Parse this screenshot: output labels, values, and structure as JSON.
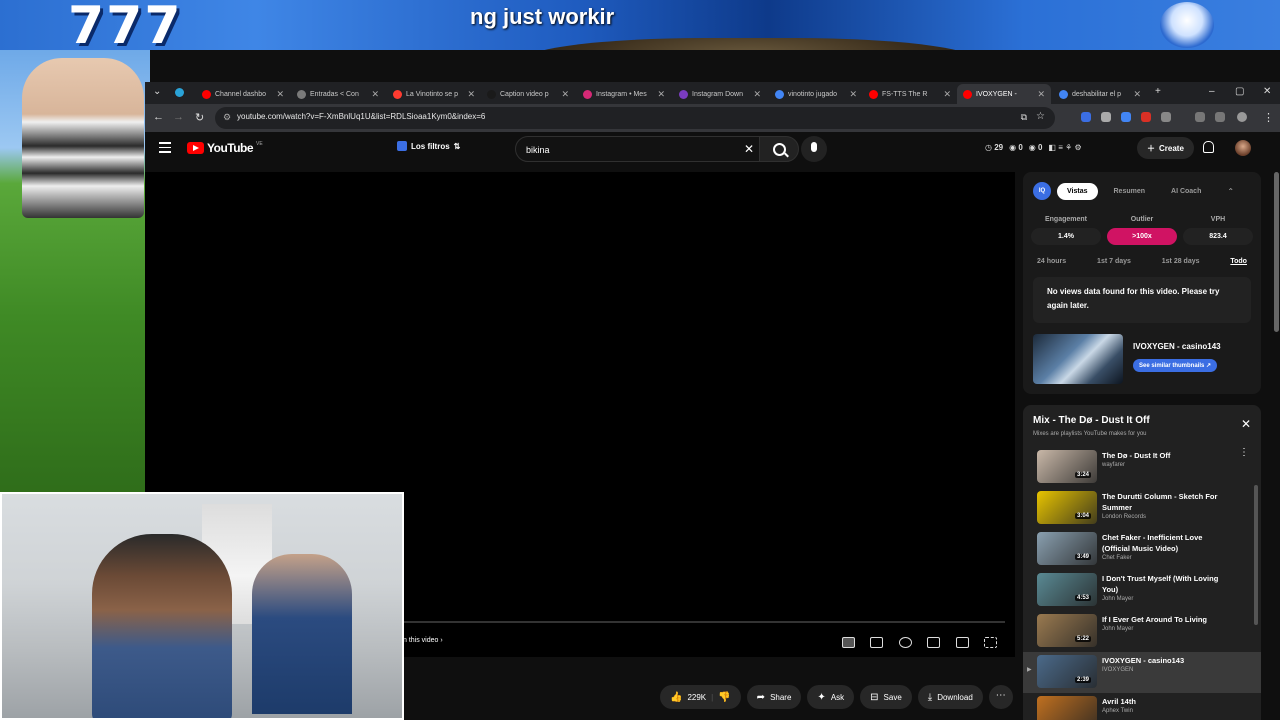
{
  "stream": {
    "overlay_number": "777",
    "caption": "ng just workir"
  },
  "browser": {
    "tabs": [
      {
        "label": "Channel dashbo",
        "color": "#ff0000"
      },
      {
        "label": "Entradas < Con",
        "color": "#7a7a7a"
      },
      {
        "label": "La Vinotinto se p",
        "color": "#ff3b30"
      },
      {
        "label": "Caption video p",
        "color": "#1a1a1a"
      },
      {
        "label": "Instagram • Mes",
        "color": "#d62976"
      },
      {
        "label": "Instagram Down",
        "color": "#7a3cc0"
      },
      {
        "label": "vinotinto jugado",
        "color": "#4285f4"
      },
      {
        "label": "FS-TTS The R",
        "color": "#ff0000"
      },
      {
        "label": "IVOXYGEN - ",
        "color": "#ff0000"
      },
      {
        "label": "deshabilitar el p",
        "color": "#4285f4"
      }
    ],
    "url": "youtube.com/watch?v=F-XmBnlUq1U&list=RDLSioaa1Kym0&index=6"
  },
  "youtube": {
    "logo_text": "YouTube",
    "logo_region": "VE",
    "filters_label": "Los filtros",
    "search_value": "bikina",
    "stats": [
      "29",
      "0",
      "0"
    ],
    "create_label": "Create"
  },
  "player": {
    "in_this_video": "n this video"
  },
  "actions": {
    "likes": "229K",
    "share": "Share",
    "ask": "Ask",
    "save": "Save",
    "download": "Download"
  },
  "iq_panel": {
    "logo": "IQ",
    "tabs": [
      "Vistas",
      "Resumen",
      "AI Coach"
    ],
    "metrics": [
      {
        "label": "Engagement",
        "value": "1.4%"
      },
      {
        "label": "Outlier",
        "value": ">100x"
      },
      {
        "label": "VPH",
        "value": "823.4"
      }
    ],
    "ranges": [
      "24 hours",
      "1st 7 days",
      "1st 28 days",
      "Todo"
    ],
    "no_data": "No views data found for this video. Please try again later.",
    "thumb_title": "IVOXYGEN - casino143",
    "thumb_button": "See similar thumbnails ↗"
  },
  "playlist": {
    "title": "Mix - The Dø - Dust It Off",
    "subtitle": "Mixes are playlists YouTube makes for you",
    "items": [
      {
        "title": "The Dø - Dust It Off",
        "artist": "wayfarer",
        "duration": "3:24",
        "color": "#c9b8a8"
      },
      {
        "title": "The Durutti Column - Sketch For Summer",
        "artist": "London Records",
        "duration": "3:04",
        "color": "#e8c400"
      },
      {
        "title": "Chet Faker - Inefficient Love (Official Music Video)",
        "artist": "Chet Faker",
        "duration": "3:49",
        "color": "#8aa0b0"
      },
      {
        "title": "I Don't Trust Myself (With Loving You)",
        "artist": "John Mayer",
        "duration": "4:53",
        "color": "#5a8a94"
      },
      {
        "title": "If I Ever Get Around To Living",
        "artist": "John Mayer",
        "duration": "5:22",
        "color": "#9a7a50"
      },
      {
        "title": "IVOXYGEN - casino143",
        "artist": "IVOXYGEN",
        "duration": "2:39",
        "color": "#4b6a8a"
      },
      {
        "title": "Avril 14th",
        "artist": "Aphex Twin",
        "duration": "",
        "color": "#c07020"
      }
    ]
  }
}
